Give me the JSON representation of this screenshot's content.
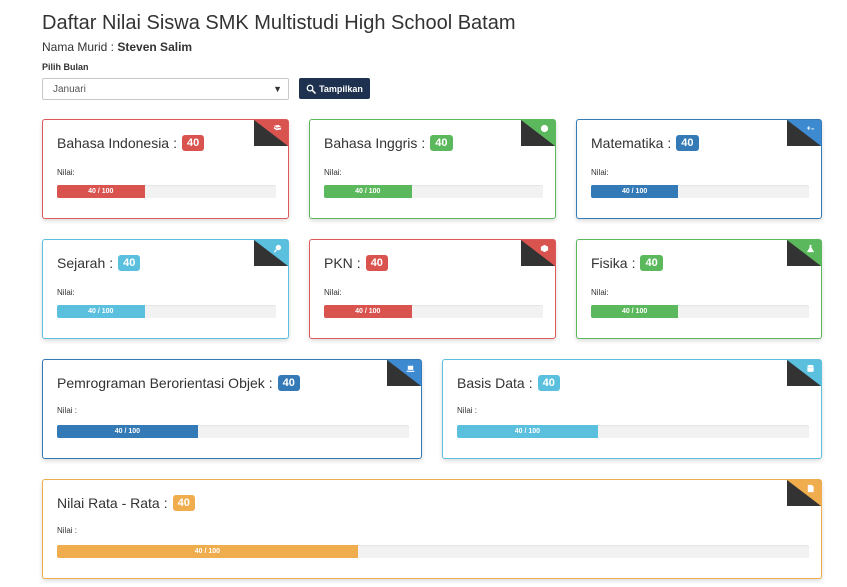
{
  "page": {
    "title": "Daftar Nilai Siswa SMK Multistudi High School Batam",
    "student_label": "Nama Murid :",
    "student_name": "Steven Salim",
    "month_label": "Pilih Bulan",
    "month_selected": "Januari",
    "show_button": "Tampilkan"
  },
  "colors": {
    "red": "#d9534f",
    "green": "#5cb85c",
    "blue": "#337ab7",
    "cyan": "#5bc0de",
    "orange": "#f0ad4e",
    "button": "#1e3250"
  },
  "subjects": [
    {
      "name": "Bahasa Indonesia",
      "score": "40",
      "nilai_label": "Nilai:",
      "bar_text": "40 / 100",
      "progress": 0.4,
      "color": "red",
      "icon": "book-icon"
    },
    {
      "name": "Bahasa Inggris",
      "score": "40",
      "nilai_label": "Nilai:",
      "bar_text": "40 / 100",
      "progress": 0.4,
      "color": "green",
      "icon": "globe-icon"
    },
    {
      "name": "Matematika",
      "score": "40",
      "nilai_label": "Nilai:",
      "bar_text": "40 / 100",
      "progress": 0.4,
      "color": "blue",
      "icon": "plus-minus-icon"
    },
    {
      "name": "Sejarah",
      "score": "40",
      "nilai_label": "Nilai:",
      "bar_text": "40 / 100",
      "progress": 0.4,
      "color": "cyan",
      "icon": "pin-icon"
    },
    {
      "name": "PKN",
      "score": "40",
      "nilai_label": "Nilai:",
      "bar_text": "40 / 100",
      "progress": 0.4,
      "color": "red",
      "icon": "emblem-icon"
    },
    {
      "name": "Fisika",
      "score": "40",
      "nilai_label": "Nilai:",
      "bar_text": "40 / 100",
      "progress": 0.4,
      "color": "green",
      "icon": "flask-icon"
    },
    {
      "name": "Pemrograman Berorientasi Objek",
      "score": "40",
      "nilai_label": "Nilai :",
      "bar_text": "40 / 100",
      "progress": 0.4,
      "color": "blue",
      "icon": "laptop-icon"
    },
    {
      "name": "Basis Data",
      "score": "40",
      "nilai_label": "Nilai :",
      "bar_text": "40 / 100",
      "progress": 0.4,
      "color": "cyan",
      "icon": "database-icon"
    },
    {
      "name": "Nilai Rata - Rata",
      "score": "40",
      "nilai_label": "Nilai :",
      "bar_text": "40 / 100",
      "progress": 0.4,
      "color": "orange",
      "icon": "document-icon"
    }
  ]
}
